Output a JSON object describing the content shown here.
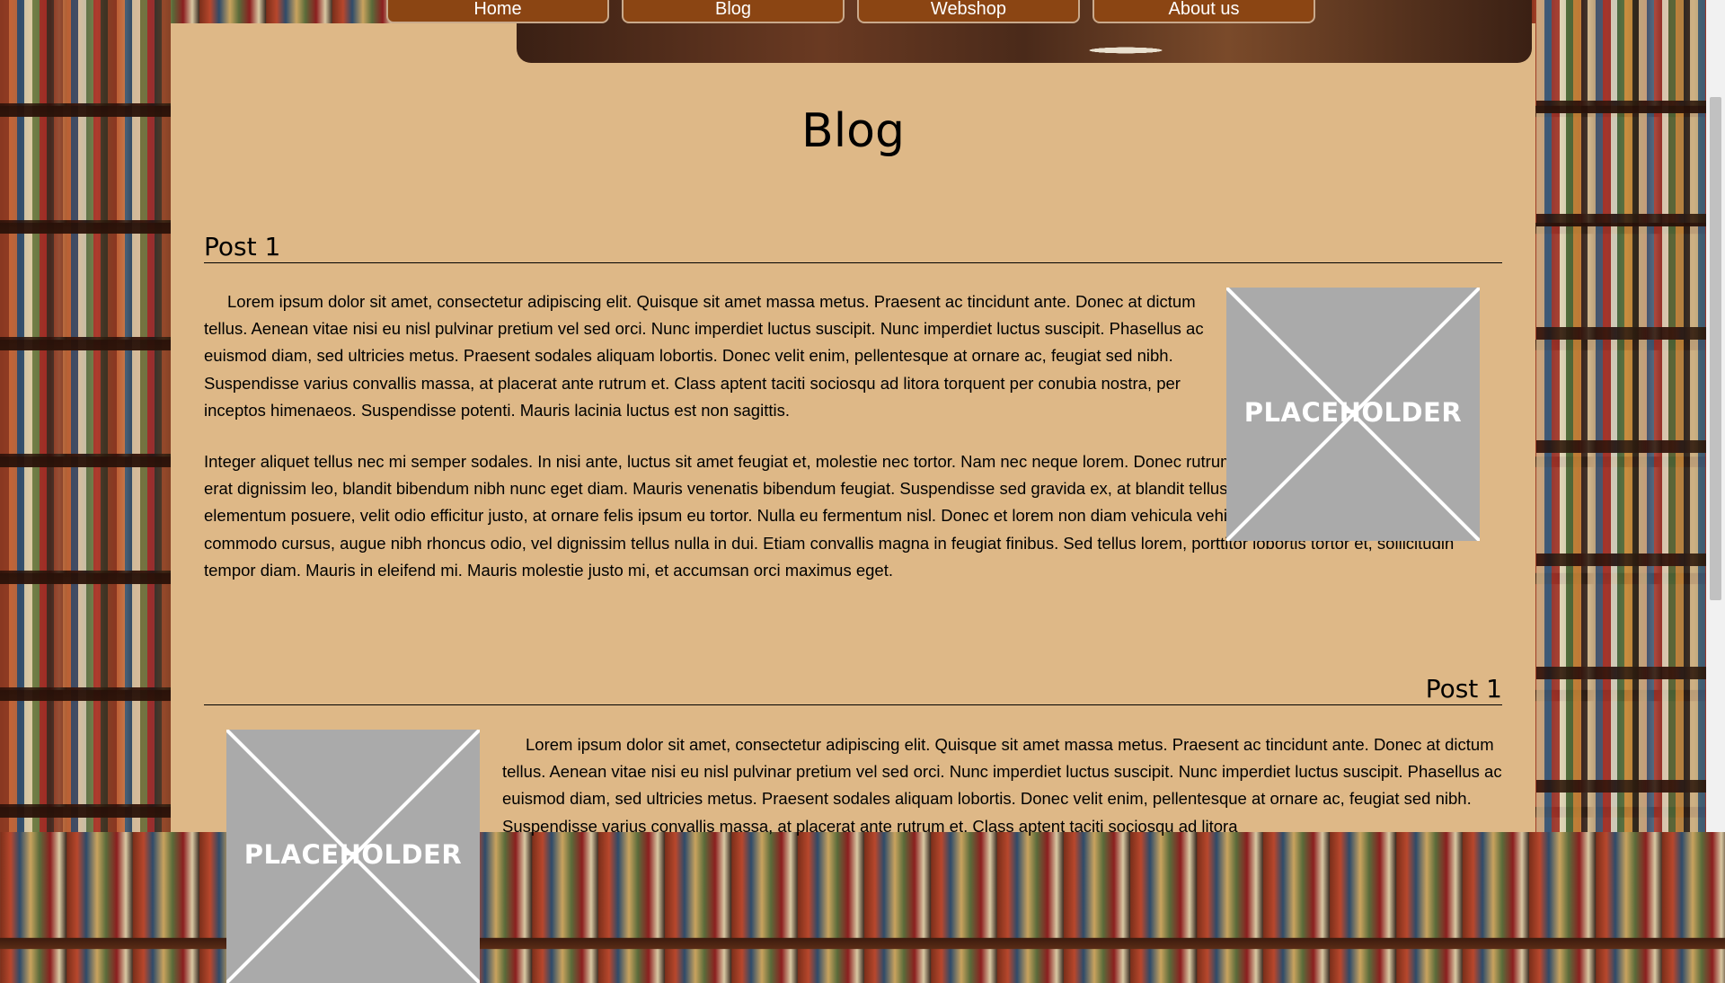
{
  "nav": {
    "items": [
      {
        "label": "Home"
      },
      {
        "label": "Blog"
      },
      {
        "label": "Webshop"
      },
      {
        "label": "About us"
      }
    ]
  },
  "page": {
    "title": "Blog"
  },
  "posts": [
    {
      "title": "Post 1",
      "image_label": "PLACEHOLDER",
      "paragraphs": [
        "Lorem ipsum dolor sit amet, consectetur adipiscing elit. Quisque sit amet massa metus. Praesent ac tincidunt ante. Donec at dictum tellus. Aenean vitae nisi eu nisl pulvinar pretium vel sed orci. Nunc imperdiet luctus suscipit. Nunc imperdiet luctus suscipit. Phasellus ac euismod diam, sed ultricies metus. Praesent sodales aliquam lobortis. Donec velit enim, pellentesque at ornare ac, feugiat sed nibh. Suspendisse varius convallis massa, at placerat ante rutrum et. Class aptent taciti sociosqu ad litora torquent per conubia nostra, per inceptos himenaeos. Suspendisse potenti. Mauris lacinia luctus est non sagittis.",
        "Integer aliquet tellus nec mi semper sodales. In nisi ante, luctus sit amet feugiat et, molestie nec tortor. Nam nec neque lorem. Donec rutrum, dolor vel convallis tempus, nulla erat dignissim leo, blandit bibendum nibh nunc eget diam. Mauris venenatis bibendum feugiat. Suspendisse sed gravida ex, at blandit tellus. Curabitur laoreet, dolor non elementum posuere, velit odio efficitur justo, at ornare felis ipsum eu tortor. Nulla eu fermentum nisl. Donec et lorem non diam vehicula vehicula. Nulla placerat, libero quis commodo cursus, augue nibh rhoncus odio, vel dignissim tellus nulla in dui. Etiam convallis magna in feugiat finibus. Sed tellus lorem, porttitor lobortis tortor et, sollicitudin tempor diam. Mauris in eleifend mi. Mauris molestie justo mi, et accumsan orci maximus eget."
      ]
    },
    {
      "title": "Post 1",
      "image_label": "PLACEHOLDER",
      "paragraphs": [
        "Lorem ipsum dolor sit amet, consectetur adipiscing elit. Quisque sit amet massa metus. Praesent ac tincidunt ante. Donec at dictum tellus. Aenean vitae nisi eu nisl pulvinar pretium vel sed orci. Nunc imperdiet luctus suscipit. Nunc imperdiet luctus suscipit. Phasellus ac euismod diam, sed ultricies metus. Praesent sodales aliquam lobortis. Donec velit enim, pellentesque at ornare ac, feugiat sed nibh. Suspendisse varius convallis massa, at placerat ante rutrum et. Class aptent taciti sociosqu ad litora"
      ]
    }
  ]
}
